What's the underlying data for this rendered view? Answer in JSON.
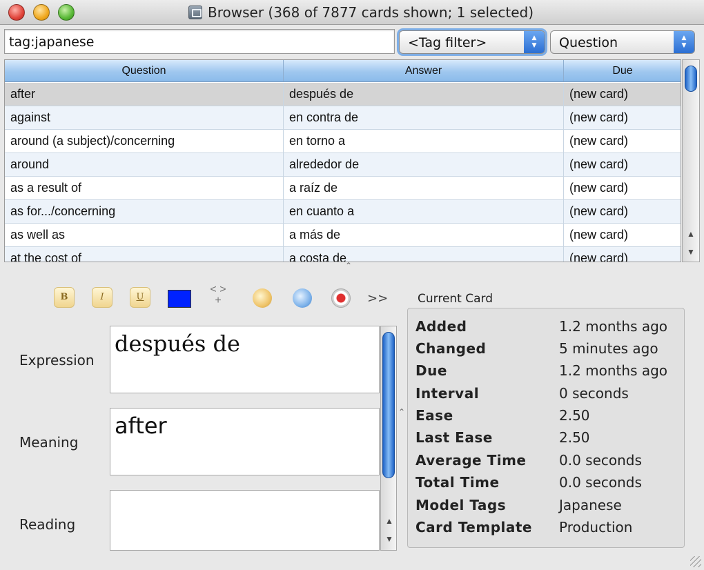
{
  "window": {
    "title": "Browser (368 of 7877 cards shown; 1 selected)"
  },
  "search": {
    "value": "tag:japanese"
  },
  "tag_filter": {
    "selected": "<Tag filter>"
  },
  "field_filter": {
    "selected": "Question"
  },
  "table": {
    "columns": [
      "Question",
      "Answer",
      "Due"
    ],
    "rows": [
      [
        "after",
        "después de",
        "(new card)"
      ],
      [
        "against",
        "en contra de",
        "(new card)"
      ],
      [
        "around (a subject)/concerning",
        "en torno a",
        "(new card)"
      ],
      [
        "around",
        "alrededor de",
        "(new card)"
      ],
      [
        "as a result of",
        "a raíz de",
        "(new card)"
      ],
      [
        "as for.../concerning",
        "en cuanto a",
        "(new card)"
      ],
      [
        "as well as",
        "a más de",
        "(new card)"
      ],
      [
        "at the cost of",
        "a costa de",
        "(new card)"
      ]
    ],
    "selected_row": 0
  },
  "toolbar": {
    "bold": "B",
    "italic": "I",
    "underline": "U",
    "text_color": "#0022ff",
    "html_edit": "< >",
    "html_plus": "+",
    "more": ">>"
  },
  "fields": [
    {
      "label": "Expression",
      "value": "después de"
    },
    {
      "label": "Meaning",
      "value": "after"
    },
    {
      "label": "Reading",
      "value": ""
    }
  ],
  "current_card": {
    "title": "Current Card",
    "rows": [
      {
        "key": "Added",
        "value": "1.2 months ago"
      },
      {
        "key": "Changed",
        "value": "5 minutes ago"
      },
      {
        "key": "Due",
        "value": "1.2 months ago"
      },
      {
        "key": "Interval",
        "value": "0 seconds"
      },
      {
        "key": "Ease",
        "value": "2.50"
      },
      {
        "key": "Last Ease",
        "value": "2.50"
      },
      {
        "key": "Average Time",
        "value": "0.0 seconds"
      },
      {
        "key": "Total Time",
        "value": "0.0 seconds"
      },
      {
        "key": "Model Tags",
        "value": "Japanese"
      },
      {
        "key": "Card Template",
        "value": "Production"
      }
    ]
  }
}
